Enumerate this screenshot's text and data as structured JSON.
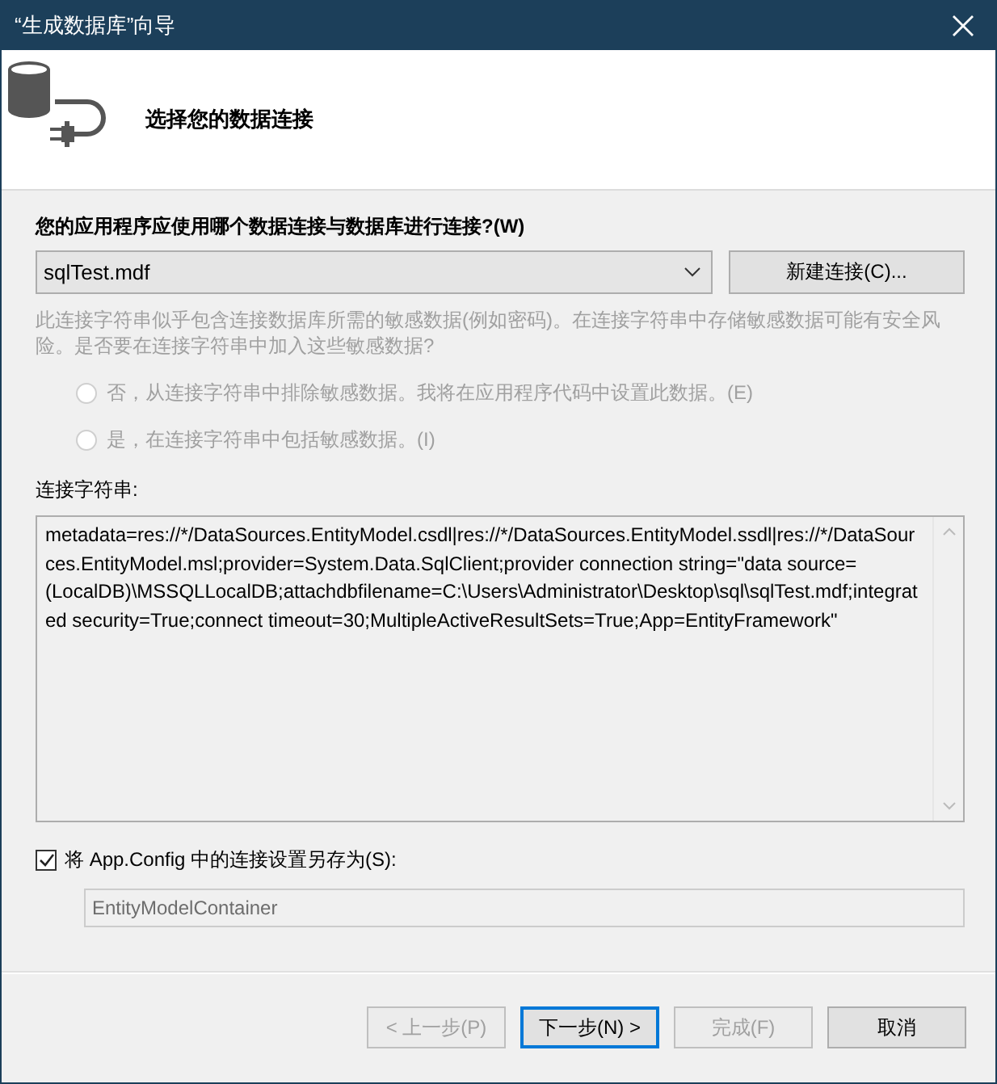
{
  "window": {
    "title": "“生成数据库”向导"
  },
  "header": {
    "title": "选择您的数据连接"
  },
  "connection": {
    "label": "您的应用程序应使用哪个数据连接与数据库进行连接?(W)",
    "value": "sqlTest.mdf",
    "new_button": "新建连接(C)..."
  },
  "sensitive": {
    "text": "此连接字符串似乎包含连接数据库所需的敏感数据(例如密码)。在连接字符串中存储敏感数据可能有安全风险。是否要在连接字符串中加入这些敏感数据?",
    "disabled": true,
    "options": [
      {
        "label": "否，从连接字符串中排除敏感数据。我将在应用程序代码中设置此数据。(E)",
        "selected": false
      },
      {
        "label": "是，在连接字符串中包括敏感数据。(I)",
        "selected": false
      }
    ]
  },
  "connection_string": {
    "label": "连接字符串:",
    "value": "metadata=res://*/DataSources.EntityModel.csdl|res://*/DataSources.EntityModel.ssdl|res://*/DataSources.EntityModel.msl;provider=System.Data.SqlClient;provider connection string=\"data source=(LocalDB)\\MSSQLLocalDB;attachdbfilename=C:\\Users\\Administrator\\Desktop\\sql\\sqlTest.mdf;integrated security=True;connect timeout=30;MultipleActiveResultSets=True;App=EntityFramework\""
  },
  "save_config": {
    "label": "将 App.Config 中的连接设置另存为(S):",
    "checked": true,
    "value": "EntityModelContainer",
    "disabled": true
  },
  "buttons": [
    {
      "label": "< 上一步(P)",
      "disabled": true,
      "default": false
    },
    {
      "label": "下一步(N) >",
      "disabled": false,
      "default": true
    },
    {
      "label": "完成(F)",
      "disabled": true,
      "default": false
    },
    {
      "label": "取消",
      "disabled": false,
      "default": false
    }
  ]
}
